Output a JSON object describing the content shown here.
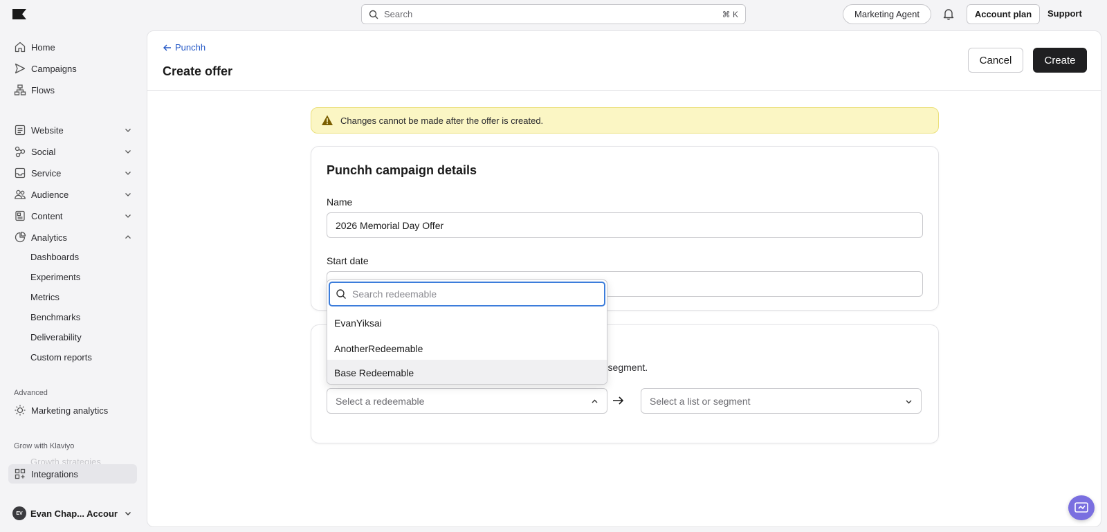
{
  "topbar": {
    "search_placeholder": "Search",
    "search_shortcut": "⌘ K",
    "marketing_agent": "Marketing Agent",
    "account_plan": "Account plan",
    "support": "Support"
  },
  "sidebar": {
    "items": [
      {
        "label": "Home"
      },
      {
        "label": "Campaigns"
      },
      {
        "label": "Flows"
      },
      {
        "label": "Website"
      },
      {
        "label": "Social"
      },
      {
        "label": "Service"
      },
      {
        "label": "Audience"
      },
      {
        "label": "Content"
      },
      {
        "label": "Analytics"
      }
    ],
    "analytics_sub": [
      "Dashboards",
      "Experiments",
      "Metrics",
      "Benchmarks",
      "Deliverability",
      "Custom reports"
    ],
    "advanced_label": "Advanced",
    "marketing_analytics": "Marketing analytics",
    "grow_label": "Grow with Klaviyo",
    "growth_strategies": "Growth strategies",
    "integrations": "Integrations",
    "account_name": "Evan Chap... Accour",
    "avatar_initials": "EV"
  },
  "header": {
    "back_label": "Punchh",
    "title": "Create offer",
    "cancel": "Cancel",
    "create": "Create"
  },
  "warning": "Changes cannot be made after the offer is created.",
  "details_card": {
    "title": "Punchh campaign details",
    "name_label": "Name",
    "name_value": "2026 Memorial Day Offer",
    "start_date_label": "Start date"
  },
  "mapping_card": {
    "helper_text": "r segment.",
    "redeemable_placeholder": "Select a redeemable",
    "list_placeholder": "Select a list or segment"
  },
  "dropdown": {
    "search_placeholder": "Search redeemable",
    "options": [
      "EvanYiksai",
      "AnotherRedeemable",
      "Base Redeemable"
    ]
  }
}
